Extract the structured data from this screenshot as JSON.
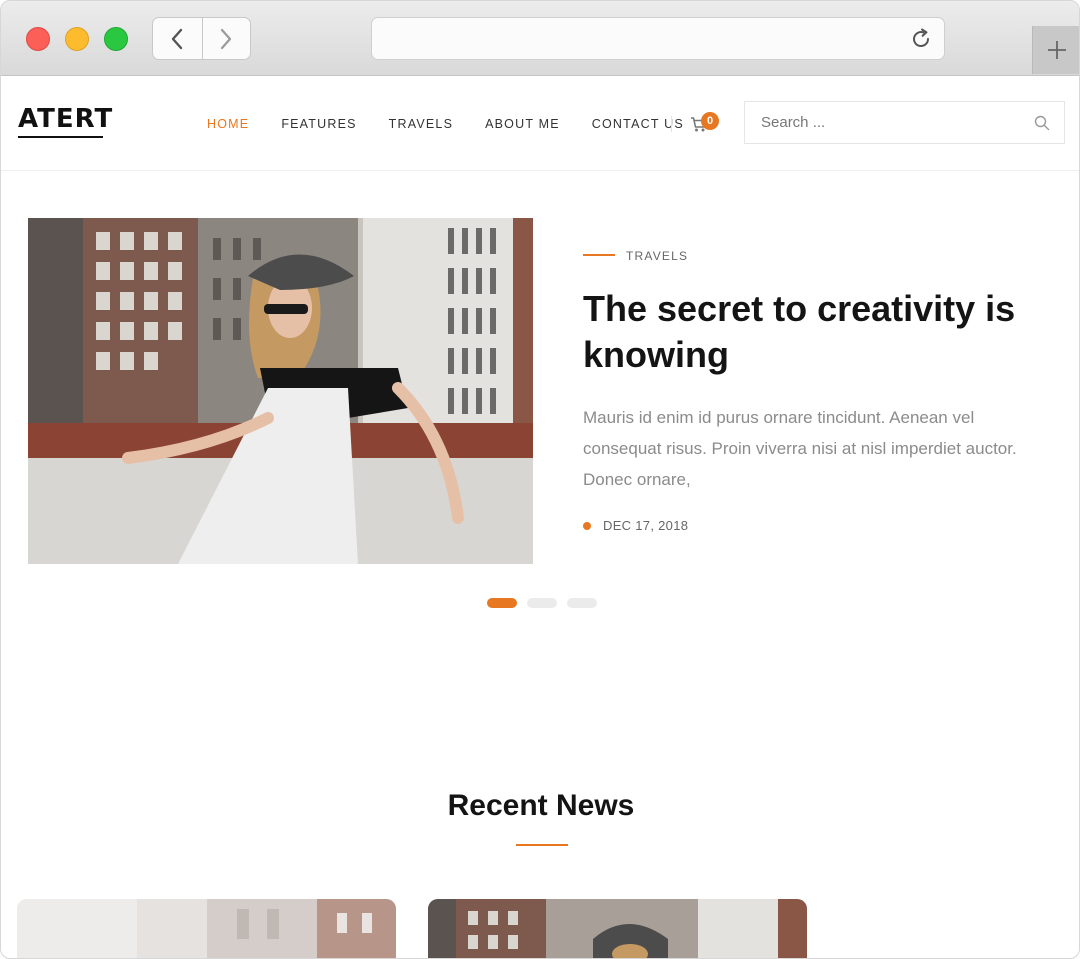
{
  "browser": {
    "url": ""
  },
  "site": {
    "logo": "ATERT",
    "nav": [
      {
        "label": "HOME"
      },
      {
        "label": "FEATURES"
      },
      {
        "label": "TRAVELS"
      },
      {
        "label": "ABOUT ME"
      },
      {
        "label": "CONTACT US"
      }
    ],
    "active_nav": "HOME",
    "cart_count": "0",
    "search_placeholder": "Search ..."
  },
  "hero": {
    "category": "TRAVELS",
    "title": "The secret to creativity is knowing",
    "excerpt": "Mauris id enim id purus ornare tincidunt. Aenean vel consequat risus. Proin viverra nisi at nisl imperdiet auctor. Donec ornare,",
    "date": "DEC 17, 2018",
    "slides_total": 3,
    "active_slide": 1
  },
  "recent_news": {
    "title": "Recent News"
  },
  "colors": {
    "accent": "#e87722",
    "heading": "#141414",
    "body_text": "#8b8b8b"
  }
}
